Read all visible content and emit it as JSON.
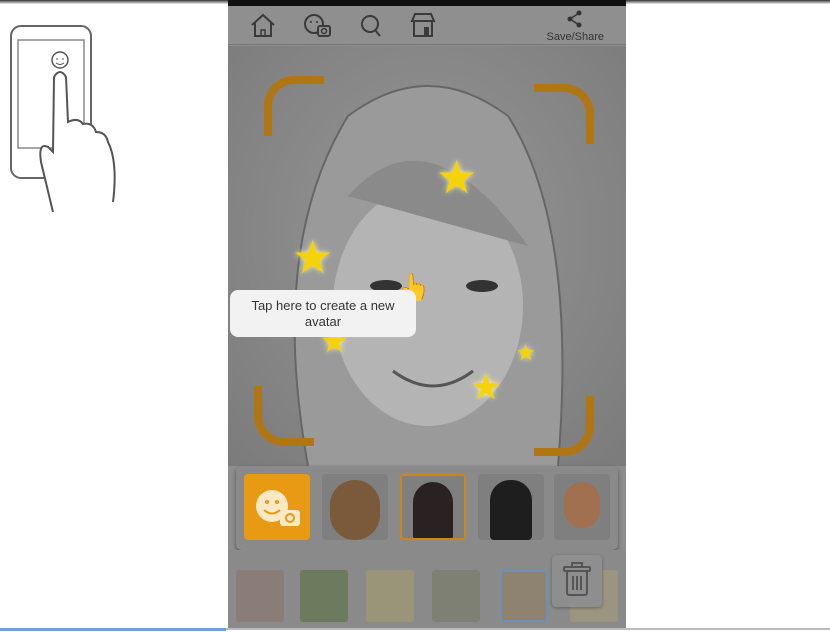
{
  "toolbar": {
    "icons": [
      "home-icon",
      "avatar-camera-icon",
      "search-icon",
      "store-icon"
    ],
    "save_share_label": "Save/Share",
    "share_icon": "share-icon"
  },
  "tooltip": {
    "text": "Tap here to create a new avatar"
  },
  "avatar_tray": {
    "create_button_icon": "smiley-camera-icon",
    "accent_color": "#e89a12",
    "selected_index": 2,
    "avatars": [
      "curly-hair-avatar",
      "long-hair-girl-avatar",
      "winking-girl-avatar",
      "young-man-avatar"
    ]
  },
  "bottom_row": {
    "items": [
      "sticker-1",
      "sticker-2",
      "sticker-3",
      "sticker-4",
      "sticker-5",
      "sticker-6"
    ],
    "selected_index": 4,
    "trash_icon": "trash-icon"
  },
  "illustration": "tap-gesture-hand-icon"
}
